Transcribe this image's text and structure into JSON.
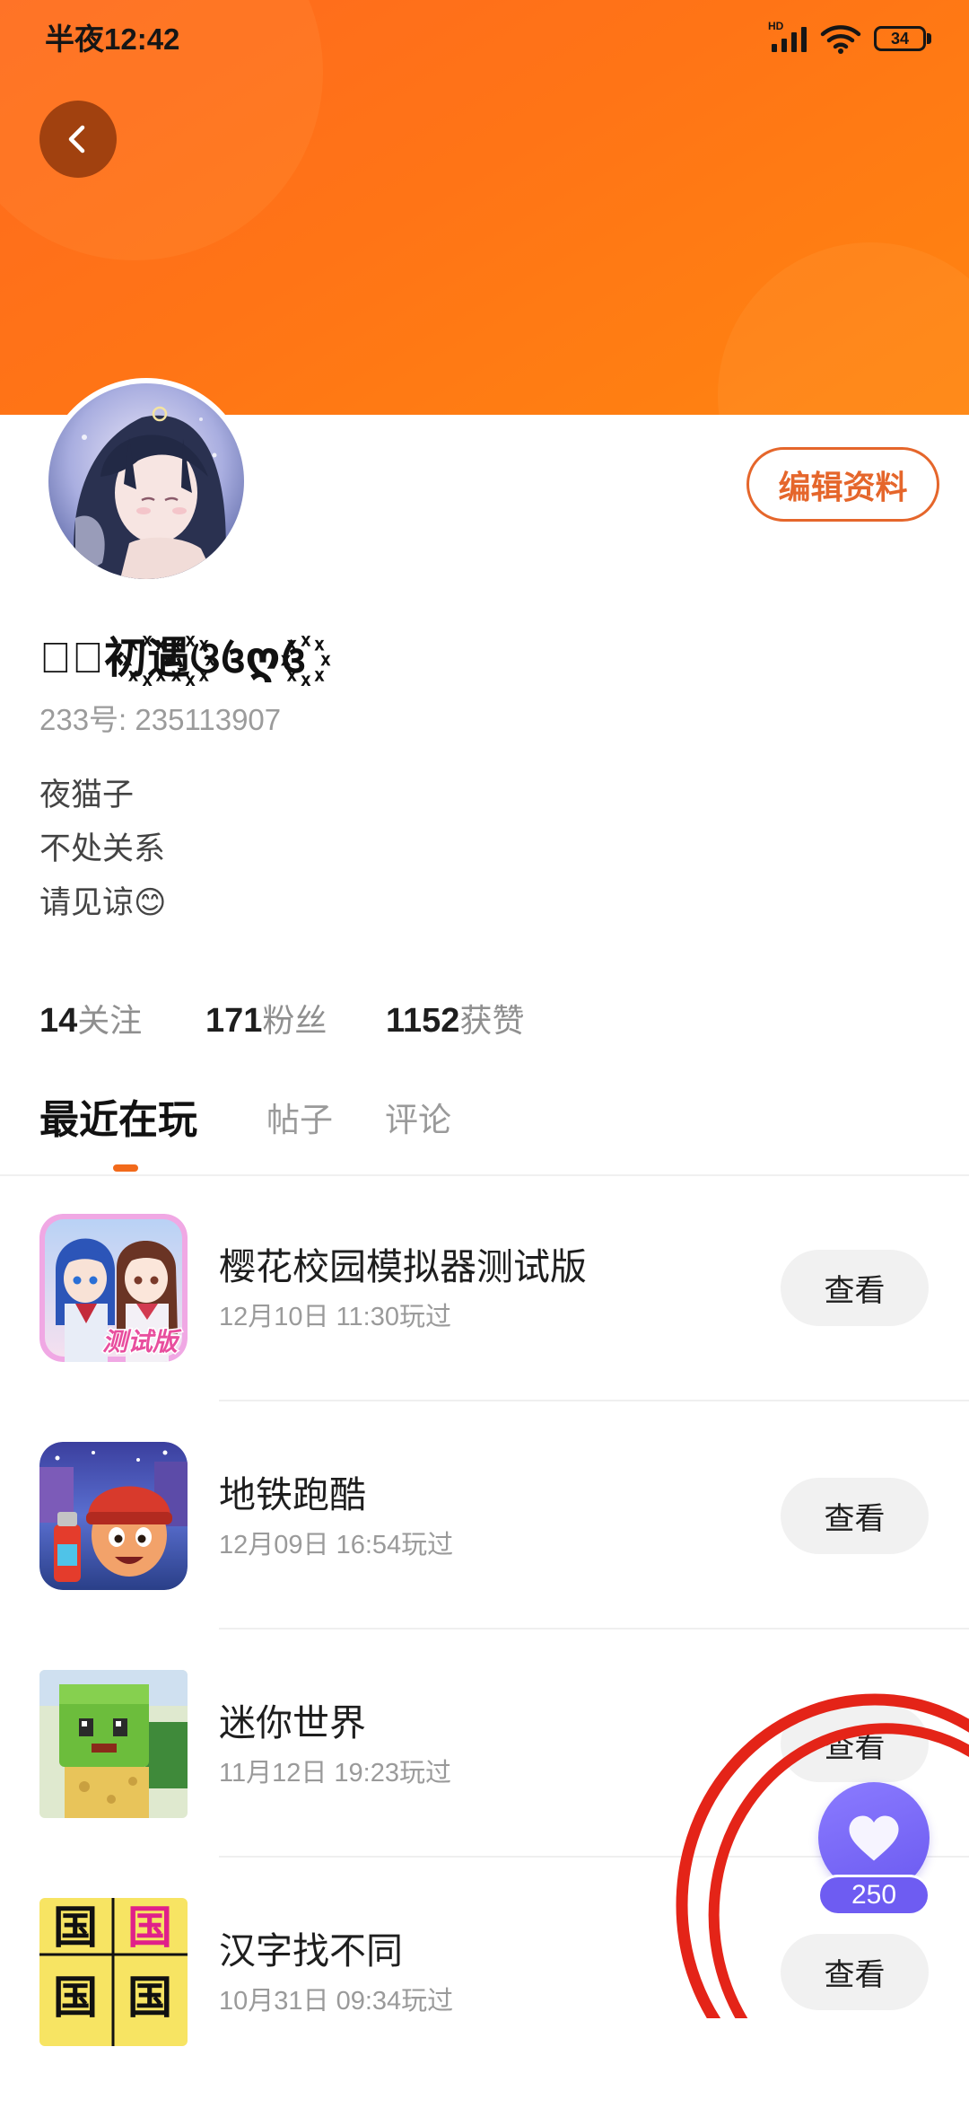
{
  "status_bar": {
    "time": "半夜12:42",
    "network": "HD",
    "battery": "34",
    "icons": [
      "cellular-signal-icon",
      "wifi-icon",
      "battery-icon"
    ]
  },
  "header": {
    "back_icon": "chevron-left-icon"
  },
  "profile": {
    "edit_label": "编辑资料",
    "username": "𝓜ꦿ初꙰遇꙰ଓ꧔ღ꧔꙰",
    "id_text": "233号: 235113907",
    "bio": [
      "夜猫子",
      "不处关系",
      "请见谅😊"
    ],
    "stats": [
      {
        "count": "14",
        "label": "关注"
      },
      {
        "count": "171",
        "label": "粉丝"
      },
      {
        "count": "1152",
        "label": "获赞"
      }
    ]
  },
  "tabs": [
    {
      "label": "最近在玩",
      "active": true
    },
    {
      "label": "帖子",
      "active": false
    },
    {
      "label": "评论",
      "active": false
    }
  ],
  "games": [
    {
      "title": "樱花校园模拟器测试版",
      "played": "12月10日 11:30玩过",
      "action": "查看",
      "icon_badge": "测试版"
    },
    {
      "title": "地铁跑酷",
      "played": "12月09日 16:54玩过",
      "action": "查看"
    },
    {
      "title": "迷你世界",
      "played": "11月12日 19:23玩过",
      "action": "查看"
    },
    {
      "title": "汉字找不同",
      "played": "10月31日 09:34玩过",
      "action": "查看",
      "icon_chars": [
        "国",
        "国",
        "国",
        "国"
      ]
    }
  ],
  "like_button": {
    "icon": "heart-icon",
    "count": "250"
  },
  "colors": {
    "banner": "#ff7416",
    "accent": "#e5662b",
    "like_button": "#7a69f6",
    "annotation": "#e42418"
  }
}
